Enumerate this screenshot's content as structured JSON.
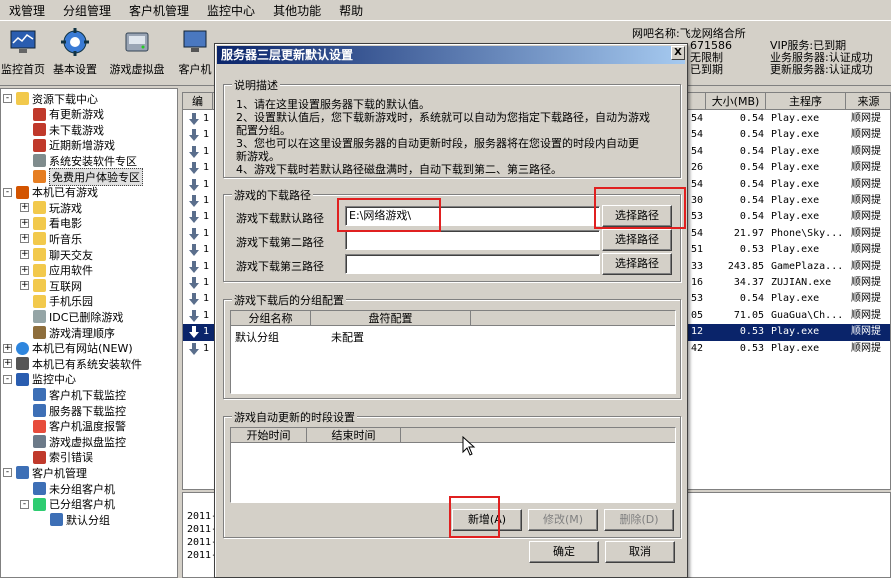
{
  "menu": [
    "戏管理",
    "分组管理",
    "客户机管理",
    "监控中心",
    "其他功能",
    "帮助"
  ],
  "toolbar": {
    "buttons": [
      {
        "label": "监控首页",
        "icon": "monitor-icon"
      },
      {
        "label": "基本设置",
        "icon": "gear-icon"
      },
      {
        "label": "游戏虚拟盘",
        "icon": "disk-icon"
      },
      {
        "label": "客户机",
        "icon": "computer-icon"
      }
    ],
    "info": {
      "line1": "网吧名称:飞龙网络合所",
      "line2": "671586",
      "line3": "无限制",
      "line4": "已到期"
    },
    "vip": {
      "line1": "VIP服务:已到期",
      "line2": "业务服务器:认证成功",
      "line3": "更新服务器:认证成功"
    }
  },
  "tree": [
    {
      "label": "资源下载中心",
      "level": 0,
      "expander": "-",
      "icon": "folder-icon"
    },
    {
      "label": "有更新游戏",
      "level": 1,
      "icon": "game-update-icon"
    },
    {
      "label": "未下载游戏",
      "level": 1,
      "icon": "game-new-icon"
    },
    {
      "label": "近期新增游戏",
      "level": 1,
      "icon": "game-recent-icon"
    },
    {
      "label": "系统安装软件专区",
      "level": 1,
      "icon": "software-icon"
    },
    {
      "label": "免费用户体验专区",
      "level": 1,
      "icon": "free-icon",
      "selected": true
    },
    {
      "label": "本机已有游戏",
      "level": 0,
      "expander": "-",
      "icon": "local-games-icon"
    },
    {
      "label": "玩游戏",
      "level": 1,
      "expander": "+",
      "icon": "folder-icon"
    },
    {
      "label": "看电影",
      "level": 1,
      "expander": "+",
      "icon": "folder-icon"
    },
    {
      "label": "听音乐",
      "level": 1,
      "expander": "+",
      "icon": "folder-icon"
    },
    {
      "label": "聊天交友",
      "level": 1,
      "expander": "+",
      "icon": "folder-icon"
    },
    {
      "label": "应用软件",
      "level": 1,
      "expander": "+",
      "icon": "folder-icon"
    },
    {
      "label": "互联网",
      "level": 1,
      "expander": "+",
      "icon": "folder-icon"
    },
    {
      "label": "手机乐园",
      "level": 1,
      "icon": "folder-icon"
    },
    {
      "label": "IDC已删除游戏",
      "level": 1,
      "icon": "deleted-icon"
    },
    {
      "label": "游戏清理顺序",
      "level": 1,
      "icon": "broom-icon"
    },
    {
      "label": "本机已有网站(NEW)",
      "level": 0,
      "expander": "+",
      "icon": "globe-icon"
    },
    {
      "label": "本机已有系统安装软件",
      "level": 0,
      "expander": "+",
      "icon": "system-icon"
    },
    {
      "label": "监控中心",
      "level": 0,
      "expander": "-",
      "icon": "monitor-icon"
    },
    {
      "label": "客户机下载监控",
      "level": 1,
      "icon": "client-download-icon"
    },
    {
      "label": "服务器下载监控",
      "level": 1,
      "icon": "server-download-icon"
    },
    {
      "label": "客户机温度报警",
      "level": 1,
      "icon": "temperature-icon"
    },
    {
      "label": "游戏虚拟盘监控",
      "level": 1,
      "icon": "virtual-disk-icon"
    },
    {
      "label": "索引错误",
      "level": 1,
      "icon": "error-icon"
    },
    {
      "label": "客户机管理",
      "level": 0,
      "expander": "-",
      "icon": "client-manage-icon"
    },
    {
      "label": "未分组客户机",
      "level": 1,
      "icon": "computer-icon"
    },
    {
      "label": "已分组客户机",
      "level": 1,
      "expander": "-",
      "icon": "computer-group-icon"
    },
    {
      "label": "默认分组",
      "level": 2,
      "icon": "computer-icon"
    }
  ],
  "grid": {
    "headers": [
      "编",
      "",
      "大小(MB)",
      "主程序",
      "来源"
    ],
    "rows": [
      {
        "num": "54",
        "size": "0.54",
        "exe": "Play.exe",
        "src": "顺网提"
      },
      {
        "num": "54",
        "size": "0.54",
        "exe": "Play.exe",
        "src": "顺网提"
      },
      {
        "num": "54",
        "size": "0.54",
        "exe": "Play.exe",
        "src": "顺网提"
      },
      {
        "num": "26",
        "size": "0.54",
        "exe": "Play.exe",
        "src": "顺网提"
      },
      {
        "num": "54",
        "size": "0.54",
        "exe": "Play.exe",
        "src": "顺网提"
      },
      {
        "num": "30",
        "size": "0.54",
        "exe": "Play.exe",
        "src": "顺网提"
      },
      {
        "num": "53",
        "size": "0.54",
        "exe": "Play.exe",
        "src": "顺网提"
      },
      {
        "num": "54",
        "size": "21.97",
        "exe": "Phone\\Sky...",
        "src": "顺网提"
      },
      {
        "num": "51",
        "size": "0.53",
        "exe": "Play.exe",
        "src": "顺网提"
      },
      {
        "num": "33",
        "size": "243.85",
        "exe": "GamePlaza...",
        "src": "顺网提"
      },
      {
        "num": "16",
        "size": "34.37",
        "exe": "ZUJIAN.exe",
        "src": "顺网提"
      },
      {
        "num": "53",
        "size": "0.54",
        "exe": "Play.exe",
        "src": "顺网提"
      },
      {
        "num": "05",
        "size": "71.05",
        "exe": "GuaGua\\Ch...",
        "src": "顺网提"
      },
      {
        "num": "12",
        "size": "0.53",
        "exe": "Play.exe",
        "src": "顺网提",
        "highlight": true
      },
      {
        "num": "42",
        "size": "0.53",
        "exe": "Play.exe",
        "src": "顺网提"
      }
    ]
  },
  "log": [
    "2011-",
    "2011-",
    "2011-",
    "2011-"
  ],
  "dialog": {
    "title": "服务器三层更新默认设置",
    "close": "X",
    "desc_title": "说明描述",
    "desc_lines": [
      "1、请在这里设置服务器下载的默认值。",
      "2、设置默认值后，您下载新游戏时，系统就可以自动为您指定下载路径，自动为游戏",
      "配置分组。",
      "3、您也可以在这里设置服务器的自动更新时段，服务器将在您设置的时段内自动更",
      "新游戏。",
      "4、游戏下载时若默认路径磁盘满时，自动下载到第二、第三路径。"
    ],
    "path_group_title": "游戏的下载路径",
    "path_labels": [
      "游戏下载默认路径",
      "游戏下载第二路径",
      "游戏下载第三路径"
    ],
    "path_values": [
      "E:\\网络游戏\\",
      "",
      ""
    ],
    "choose_label": "选择路径",
    "group_title": "游戏下载后的分组配置",
    "group_headers": [
      "分组名称",
      "盘符配置"
    ],
    "group_rows": [
      {
        "name": "默认分组",
        "config": "未配置"
      }
    ],
    "time_title": "游戏自动更新的时段设置",
    "time_headers": [
      "开始时间",
      "结束时间"
    ],
    "btn_new": "新增(A)",
    "btn_edit": "修改(M)",
    "btn_delete": "删除(D)",
    "btn_ok": "确定",
    "btn_cancel": "取消"
  }
}
